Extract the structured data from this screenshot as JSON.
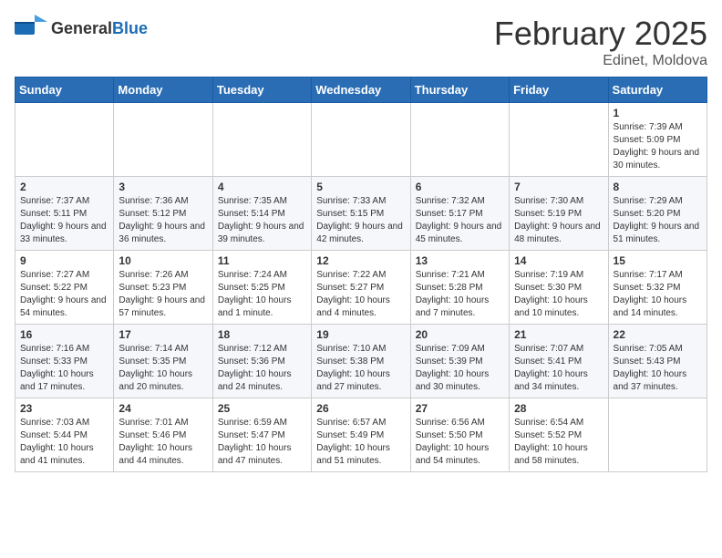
{
  "header": {
    "logo_general": "General",
    "logo_blue": "Blue",
    "title": "February 2025",
    "location": "Edinet, Moldova"
  },
  "weekdays": [
    "Sunday",
    "Monday",
    "Tuesday",
    "Wednesday",
    "Thursday",
    "Friday",
    "Saturday"
  ],
  "weeks": [
    [
      {
        "day": "",
        "info": ""
      },
      {
        "day": "",
        "info": ""
      },
      {
        "day": "",
        "info": ""
      },
      {
        "day": "",
        "info": ""
      },
      {
        "day": "",
        "info": ""
      },
      {
        "day": "",
        "info": ""
      },
      {
        "day": "1",
        "info": "Sunrise: 7:39 AM\nSunset: 5:09 PM\nDaylight: 9 hours and 30 minutes."
      }
    ],
    [
      {
        "day": "2",
        "info": "Sunrise: 7:37 AM\nSunset: 5:11 PM\nDaylight: 9 hours and 33 minutes."
      },
      {
        "day": "3",
        "info": "Sunrise: 7:36 AM\nSunset: 5:12 PM\nDaylight: 9 hours and 36 minutes."
      },
      {
        "day": "4",
        "info": "Sunrise: 7:35 AM\nSunset: 5:14 PM\nDaylight: 9 hours and 39 minutes."
      },
      {
        "day": "5",
        "info": "Sunrise: 7:33 AM\nSunset: 5:15 PM\nDaylight: 9 hours and 42 minutes."
      },
      {
        "day": "6",
        "info": "Sunrise: 7:32 AM\nSunset: 5:17 PM\nDaylight: 9 hours and 45 minutes."
      },
      {
        "day": "7",
        "info": "Sunrise: 7:30 AM\nSunset: 5:19 PM\nDaylight: 9 hours and 48 minutes."
      },
      {
        "day": "8",
        "info": "Sunrise: 7:29 AM\nSunset: 5:20 PM\nDaylight: 9 hours and 51 minutes."
      }
    ],
    [
      {
        "day": "9",
        "info": "Sunrise: 7:27 AM\nSunset: 5:22 PM\nDaylight: 9 hours and 54 minutes."
      },
      {
        "day": "10",
        "info": "Sunrise: 7:26 AM\nSunset: 5:23 PM\nDaylight: 9 hours and 57 minutes."
      },
      {
        "day": "11",
        "info": "Sunrise: 7:24 AM\nSunset: 5:25 PM\nDaylight: 10 hours and 1 minute."
      },
      {
        "day": "12",
        "info": "Sunrise: 7:22 AM\nSunset: 5:27 PM\nDaylight: 10 hours and 4 minutes."
      },
      {
        "day": "13",
        "info": "Sunrise: 7:21 AM\nSunset: 5:28 PM\nDaylight: 10 hours and 7 minutes."
      },
      {
        "day": "14",
        "info": "Sunrise: 7:19 AM\nSunset: 5:30 PM\nDaylight: 10 hours and 10 minutes."
      },
      {
        "day": "15",
        "info": "Sunrise: 7:17 AM\nSunset: 5:32 PM\nDaylight: 10 hours and 14 minutes."
      }
    ],
    [
      {
        "day": "16",
        "info": "Sunrise: 7:16 AM\nSunset: 5:33 PM\nDaylight: 10 hours and 17 minutes."
      },
      {
        "day": "17",
        "info": "Sunrise: 7:14 AM\nSunset: 5:35 PM\nDaylight: 10 hours and 20 minutes."
      },
      {
        "day": "18",
        "info": "Sunrise: 7:12 AM\nSunset: 5:36 PM\nDaylight: 10 hours and 24 minutes."
      },
      {
        "day": "19",
        "info": "Sunrise: 7:10 AM\nSunset: 5:38 PM\nDaylight: 10 hours and 27 minutes."
      },
      {
        "day": "20",
        "info": "Sunrise: 7:09 AM\nSunset: 5:39 PM\nDaylight: 10 hours and 30 minutes."
      },
      {
        "day": "21",
        "info": "Sunrise: 7:07 AM\nSunset: 5:41 PM\nDaylight: 10 hours and 34 minutes."
      },
      {
        "day": "22",
        "info": "Sunrise: 7:05 AM\nSunset: 5:43 PM\nDaylight: 10 hours and 37 minutes."
      }
    ],
    [
      {
        "day": "23",
        "info": "Sunrise: 7:03 AM\nSunset: 5:44 PM\nDaylight: 10 hours and 41 minutes."
      },
      {
        "day": "24",
        "info": "Sunrise: 7:01 AM\nSunset: 5:46 PM\nDaylight: 10 hours and 44 minutes."
      },
      {
        "day": "25",
        "info": "Sunrise: 6:59 AM\nSunset: 5:47 PM\nDaylight: 10 hours and 47 minutes."
      },
      {
        "day": "26",
        "info": "Sunrise: 6:57 AM\nSunset: 5:49 PM\nDaylight: 10 hours and 51 minutes."
      },
      {
        "day": "27",
        "info": "Sunrise: 6:56 AM\nSunset: 5:50 PM\nDaylight: 10 hours and 54 minutes."
      },
      {
        "day": "28",
        "info": "Sunrise: 6:54 AM\nSunset: 5:52 PM\nDaylight: 10 hours and 58 minutes."
      },
      {
        "day": "",
        "info": ""
      }
    ]
  ]
}
